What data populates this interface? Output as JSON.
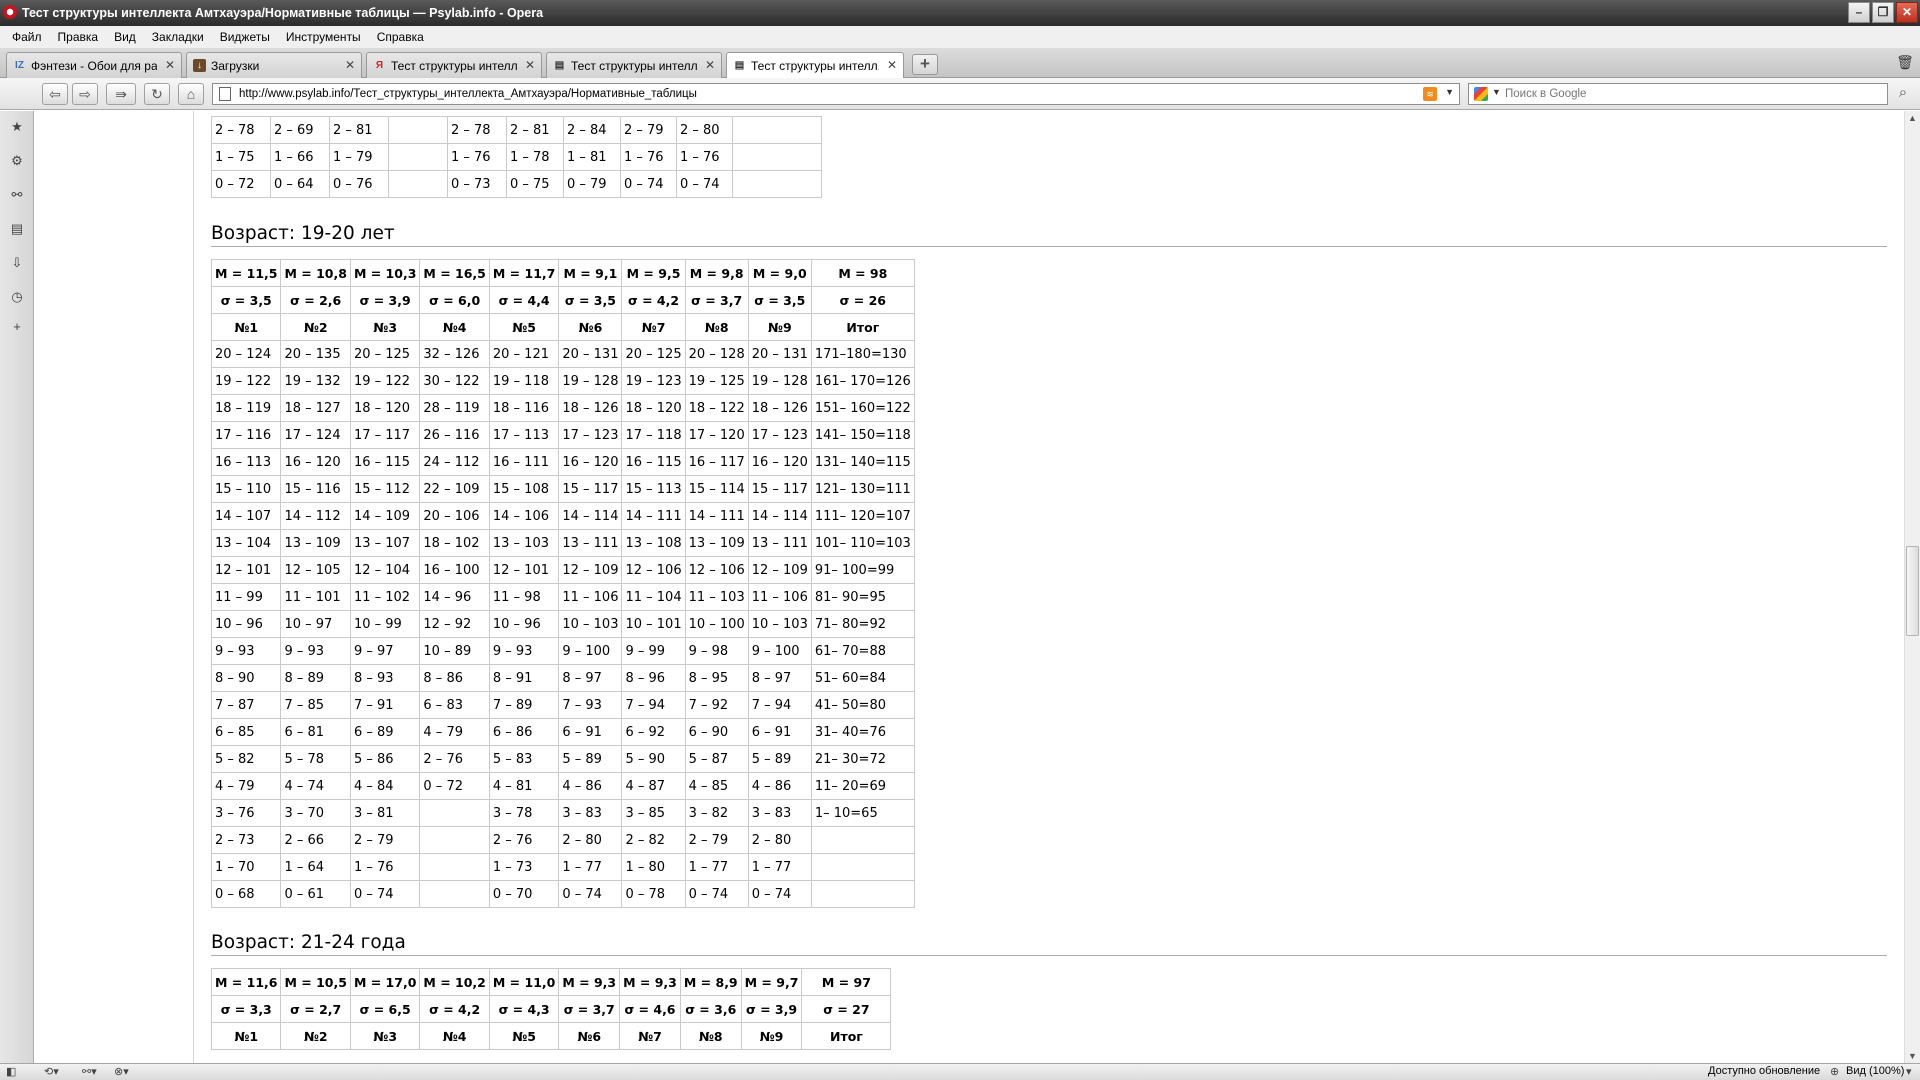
{
  "window": {
    "title": "Тест структуры интеллекта Амтхауэра/Нормативные таблицы — Psylab.info - Opera",
    "controls": [
      "–",
      "❐",
      "✕"
    ]
  },
  "menu": [
    "Файл",
    "Правка",
    "Вид",
    "Закладки",
    "Виджеты",
    "Инструменты",
    "Справка"
  ],
  "tabs": [
    {
      "label": "Фэнтези - Обои для ра...",
      "icon": "IZ",
      "close": "✕"
    },
    {
      "label": "Загрузки",
      "icon": "↓",
      "close": "✕"
    },
    {
      "label": "Тест структуры интелл...",
      "icon": "Я",
      "close": "✕"
    },
    {
      "label": "Тест структуры интелл...",
      "icon": "▤",
      "close": "✕"
    },
    {
      "label": "Тест структуры интелл...",
      "icon": "▤",
      "close": "✕"
    }
  ],
  "new_tab": "+",
  "address": {
    "url": "http://www.psylab.info/Тест_структуры_интеллекта_Амтхауэра/Нормативные_таблицы"
  },
  "search": {
    "placeholder": "Поиск в Google"
  },
  "status": {
    "update": "Доступно обновление",
    "zoom": "Вид (100%)"
  },
  "content": {
    "prev_table": {
      "rows": [
        [
          "2 – 78",
          "2 – 69",
          "2 – 81",
          "",
          "2 – 78",
          "2 – 81",
          "2 – 84",
          "2 – 79",
          "2 – 80",
          ""
        ],
        [
          "1 – 75",
          "1 – 66",
          "1 – 79",
          "",
          "1 – 76",
          "1 – 78",
          "1 – 81",
          "1 – 76",
          "1 – 76",
          ""
        ],
        [
          "0 – 72",
          "0 – 64",
          "0 – 76",
          "",
          "0 – 73",
          "0 – 75",
          "0 – 79",
          "0 – 74",
          "0 – 74",
          ""
        ]
      ]
    },
    "section_19_20": {
      "heading": "Возраст: 19-20 лет",
      "means": [
        "M = 11,5",
        "M = 10,8",
        "M = 10,3",
        "M = 16,5",
        "M = 11,7",
        "M = 9,1",
        "M = 9,5",
        "M = 9,8",
        "M = 9,0",
        "M = 98"
      ],
      "sigmas": [
        "σ = 3,5",
        "σ = 2,6",
        "σ = 3,9",
        "σ = 6,0",
        "σ = 4,4",
        "σ = 3,5",
        "σ = 4,2",
        "σ = 3,7",
        "σ = 3,5",
        "σ = 26"
      ],
      "cols": [
        "№1",
        "№2",
        "№3",
        "№4",
        "№5",
        "№6",
        "№7",
        "№8",
        "№9",
        "Итог"
      ],
      "rows": [
        [
          "20 – 124",
          "20 – 135",
          "20 – 125",
          "32 – 126",
          "20 – 121",
          "20 – 131",
          "20 – 125",
          "20 – 128",
          "20 – 131",
          "171–180=130"
        ],
        [
          "19 – 122",
          "19 – 132",
          "19 – 122",
          "30 – 122",
          "19 – 118",
          "19 – 128",
          "19 – 123",
          "19 – 125",
          "19 – 128",
          "161– 170=126"
        ],
        [
          "18 – 119",
          "18 – 127",
          "18 – 120",
          "28 – 119",
          "18 – 116",
          "18 – 126",
          "18 – 120",
          "18 – 122",
          "18 – 126",
          "151– 160=122"
        ],
        [
          "17 – 116",
          "17 – 124",
          "17 – 117",
          "26 – 116",
          "17 – 113",
          "17 – 123",
          "17 – 118",
          "17 – 120",
          "17 – 123",
          "141– 150=118"
        ],
        [
          "16 – 113",
          "16 – 120",
          "16 – 115",
          "24 – 112",
          "16 – 111",
          "16 – 120",
          "16 – 115",
          "16 – 117",
          "16 – 120",
          "131– 140=115"
        ],
        [
          "15 – 110",
          "15 – 116",
          "15 – 112",
          "22 – 109",
          "15 – 108",
          "15 – 117",
          "15 – 113",
          "15 – 114",
          "15 – 117",
          "121– 130=111"
        ],
        [
          "14 – 107",
          "14 – 112",
          "14 – 109",
          "20 – 106",
          "14 – 106",
          "14 – 114",
          "14 – 111",
          "14 – 111",
          "14 – 114",
          "111– 120=107"
        ],
        [
          "13 – 104",
          "13 – 109",
          "13 – 107",
          "18 – 102",
          "13 – 103",
          "13 – 111",
          "13 – 108",
          "13 – 109",
          "13 – 111",
          "101– 110=103"
        ],
        [
          "12 – 101",
          "12 – 105",
          "12 – 104",
          "16 – 100",
          "12 – 101",
          "12 – 109",
          "12 – 106",
          "12 – 106",
          "12 – 109",
          "91– 100=99"
        ],
        [
          "11 – 99",
          "11 – 101",
          "11 – 102",
          "14 – 96",
          "11 – 98",
          "11 – 106",
          "11 – 104",
          "11 – 103",
          "11 – 106",
          "81– 90=95"
        ],
        [
          "10 – 96",
          "10 – 97",
          "10 – 99",
          "12 – 92",
          "10 – 96",
          "10 – 103",
          "10 – 101",
          "10 – 100",
          "10 – 103",
          "71– 80=92"
        ],
        [
          "9 – 93",
          "9 – 93",
          "9 – 97",
          "10 – 89",
          "9 – 93",
          "9 – 100",
          "9 – 99",
          "9 – 98",
          "9 – 100",
          "61– 70=88"
        ],
        [
          "8 – 90",
          "8 – 89",
          "8 – 93",
          "8 – 86",
          "8 – 91",
          "8 – 97",
          "8 – 96",
          "8 – 95",
          "8 – 97",
          "51– 60=84"
        ],
        [
          "7 – 87",
          "7 – 85",
          "7 – 91",
          "6 – 83",
          "7 – 89",
          "7 – 93",
          "7 – 94",
          "7 – 92",
          "7 – 94",
          "41– 50=80"
        ],
        [
          "6 – 85",
          "6 – 81",
          "6 – 89",
          "4 – 79",
          "6 – 86",
          "6 – 91",
          "6 – 92",
          "6 – 90",
          "6 – 91",
          "31– 40=76"
        ],
        [
          "5 – 82",
          "5 – 78",
          "5 – 86",
          "2 – 76",
          "5 – 83",
          "5 – 89",
          "5 – 90",
          "5 – 87",
          "5 – 89",
          "21– 30=72"
        ],
        [
          "4 – 79",
          "4 – 74",
          "4 – 84",
          "0 – 72",
          "4 – 81",
          "4 – 86",
          "4 – 87",
          "4 – 85",
          "4 – 86",
          "11– 20=69"
        ],
        [
          "3 – 76",
          "3 – 70",
          "3 – 81",
          "",
          "3 – 78",
          "3 – 83",
          "3 – 85",
          "3 – 82",
          "3 – 83",
          "1– 10=65"
        ],
        [
          "2 – 73",
          "2 – 66",
          "2 – 79",
          "",
          "2 – 76",
          "2 – 80",
          "2 – 82",
          "2 – 79",
          "2 – 80",
          ""
        ],
        [
          "1 – 70",
          "1 – 64",
          "1 – 76",
          "",
          "1 – 73",
          "1 – 77",
          "1 – 80",
          "1 – 77",
          "1 – 77",
          ""
        ],
        [
          "0 – 68",
          "0 – 61",
          "0 – 74",
          "",
          "0 – 70",
          "0 – 74",
          "0 – 78",
          "0 – 74",
          "0 – 74",
          ""
        ]
      ]
    },
    "section_21_24": {
      "heading": "Возраст: 21-24 года",
      "means": [
        "M = 11,6",
        "M = 10,5",
        "M = 17,0",
        "M = 10,2",
        "M = 11,0",
        "M = 9,3",
        "M = 9,3",
        "M = 8,9",
        "M = 9,7",
        "M = 97"
      ],
      "sigmas": [
        "σ = 3,3",
        "σ = 2,7",
        "σ = 6,5",
        "σ = 4,2",
        "σ = 4,3",
        "σ = 3,7",
        "σ = 4,6",
        "σ = 3,6",
        "σ = 3,9",
        "σ = 27"
      ],
      "cols": [
        "№1",
        "№2",
        "№3",
        "№4",
        "№5",
        "№6",
        "№7",
        "№8",
        "№9",
        "Итог"
      ]
    }
  }
}
